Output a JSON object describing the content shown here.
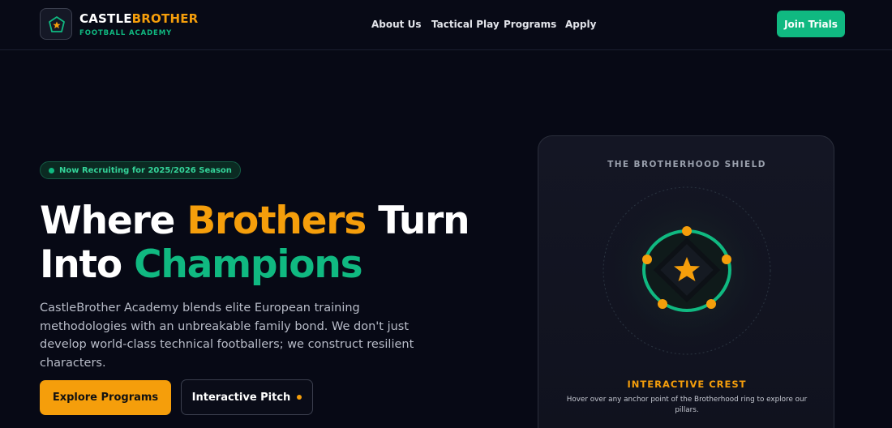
{
  "brand": {
    "name_part1": "CASTLE",
    "name_part2": "BROTHER",
    "subtitle": "FOOTBALL ACADEMY",
    "logo_icon": "shield-star-icon"
  },
  "nav": {
    "items": [
      "About Us",
      "Tactical Play",
      "Programs",
      "Apply"
    ],
    "cta": "Join Trials"
  },
  "hero": {
    "badge": "Now Recruiting for 2025/2026 Season",
    "title_line1": [
      "Where ",
      "Brothers",
      " Turn"
    ],
    "title_line2": [
      "Into ",
      "Champions"
    ],
    "description": "CastleBrother Academy blends elite European training methodologies with an unbreakable family bond. We don't just develop world-class technical footballers; we construct resilient characters.",
    "primary_button": "Explore Programs",
    "secondary_button": "Interactive Pitch"
  },
  "crest_card": {
    "title": "THE BROTHERHOOD SHIELD",
    "label": "INTERACTIVE CREST",
    "description": "Hover over any anchor point of the Brotherhood ring to explore our pillars.",
    "icon": "star-icon"
  },
  "colors": {
    "accent_orange": "#f59e0b",
    "accent_green": "#10b981",
    "background": "#070915"
  }
}
